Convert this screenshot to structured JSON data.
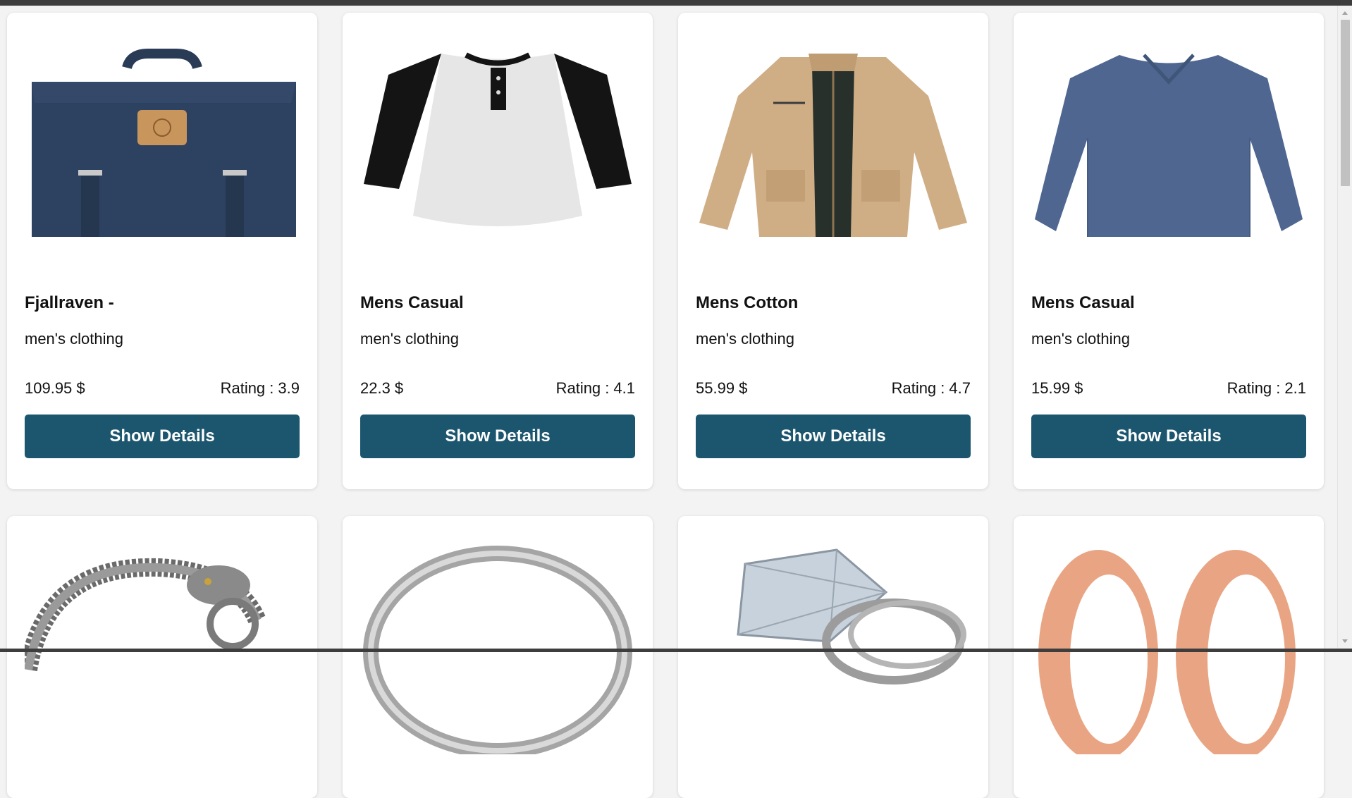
{
  "products": [
    {
      "title": "Fjallraven -",
      "category": "men's clothing",
      "price": "109.95 $",
      "rating_label": "Rating :",
      "rating": "3.9",
      "button_label": "Show Details",
      "image_icon": "backpack-image"
    },
    {
      "title": "Mens Casual",
      "category": "men's clothing",
      "price": "22.3 $",
      "rating_label": "Rating :",
      "rating": "4.1",
      "button_label": "Show Details",
      "image_icon": "raglan-tshirt-image"
    },
    {
      "title": "Mens Cotton",
      "category": "men's clothing",
      "price": "55.99 $",
      "rating_label": "Rating :",
      "rating": "4.7",
      "button_label": "Show Details",
      "image_icon": "cotton-jacket-image"
    },
    {
      "title": "Mens Casual",
      "category": "men's clothing",
      "price": "15.99 $",
      "rating_label": "Rating :",
      "rating": "2.1",
      "button_label": "Show Details",
      "image_icon": "slim-fit-shirt-image"
    },
    {
      "image_icon": "dragon-bracelet-image"
    },
    {
      "image_icon": "silver-ring-image"
    },
    {
      "image_icon": "diamond-ring-set-image"
    },
    {
      "image_icon": "rose-gold-earrings-image"
    }
  ],
  "colors": {
    "button_bg": "#1c566e",
    "button_text": "#ffffff",
    "card_bg": "#ffffff",
    "page_bg": "#f3f3f3"
  }
}
